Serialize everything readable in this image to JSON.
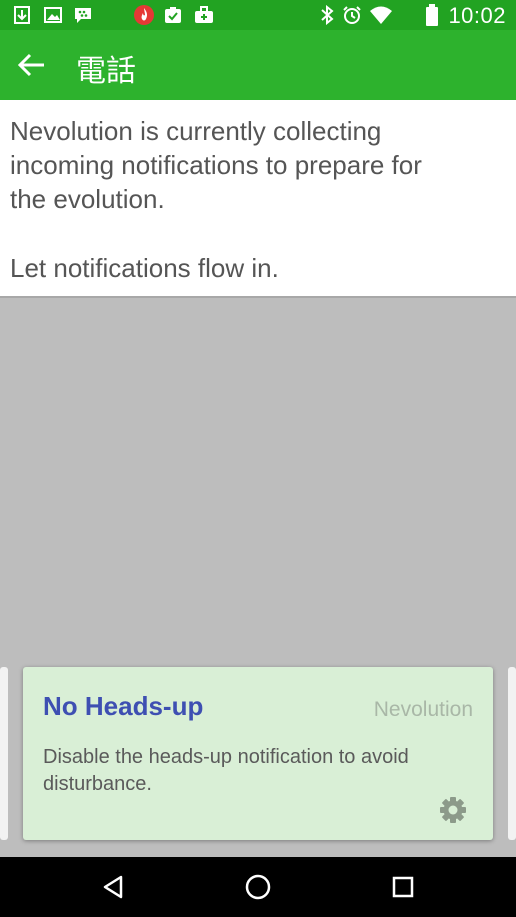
{
  "status_bar": {
    "time": "10:02",
    "left_icons": [
      "download-icon",
      "image-icon",
      "bbm-icon",
      "vpn-fire-icon",
      "clipboard-check-icon",
      "briefcase-icon"
    ],
    "right_icons": [
      "bluetooth-icon",
      "alarm-icon",
      "wifi-icon",
      "battery-icon"
    ]
  },
  "app_bar": {
    "title": "電話",
    "back_icon": "arrow-back-icon"
  },
  "message": {
    "lines": [
      "Nevolution is currently collecting",
      "incoming notifications to prepare for",
      "the evolution.",
      "Let notifications flow in."
    ]
  },
  "card": {
    "title": "No Heads-up",
    "source": "Nevolution",
    "description_lines": [
      "Disable the heads-up notification to avoid",
      "disturbance."
    ],
    "settings_icon": "gear-icon"
  },
  "nav_bar": {
    "buttons": [
      "back-triangle-icon",
      "home-circle-icon",
      "recents-square-icon"
    ]
  },
  "colors": {
    "status_bar": "#22a322",
    "app_bar": "#2db22d",
    "card_background": "#d9efd6",
    "card_title": "#3e4fb2",
    "backdrop": "#bdbdbd"
  }
}
